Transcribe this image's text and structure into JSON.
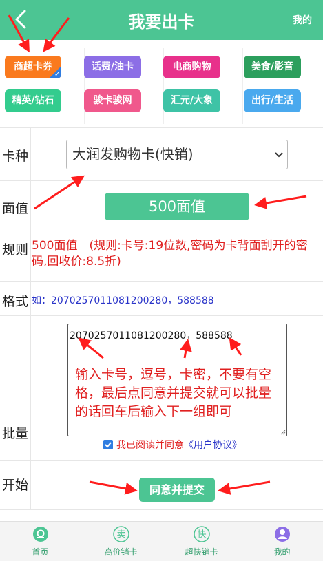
{
  "header": {
    "title": "我要出卡",
    "right_label": "我的",
    "bg_color": "#4cc593"
  },
  "categories": [
    {
      "label": "商超卡券",
      "color": "#fa7a1e",
      "selected": true
    },
    {
      "label": "话费/油卡",
      "color": "#8c6ee6"
    },
    {
      "label": "电商购物",
      "color": "#e8318b"
    },
    {
      "label": "美食/影音",
      "color": "#2c9f5d"
    },
    {
      "label": "精英/钻石",
      "color": "#33cc8e"
    },
    {
      "label": "骏卡骏网",
      "color": "#f0588c"
    },
    {
      "label": "汇元/大象",
      "color": "#3ec3a6"
    },
    {
      "label": "出行/生活",
      "color": "#4aa9ee"
    }
  ],
  "form": {
    "card_type_label": "卡种",
    "card_type_value": "大润发购物卡(快销)",
    "face_value_label": "面值",
    "face_value": "500面值",
    "rule_label": "规则",
    "rule_text": "500面值　(规则:卡号:19位数,密码为卡背面刮开的密码,回收价:8.5折)",
    "format_label": "格式",
    "format_text": "如：207025701108120028​0，588588",
    "batch_label": "批量",
    "batch_value": "2070257011081200280，588588",
    "batch_hint": "输入卡号，逗号，卡密，不要有空格，最后点同意并提交就可以批量的话回车后输入下一组即可",
    "agree_text": "我已阅读并同意",
    "agreement_link": "《用户协议》",
    "agreed": true,
    "start_label": "开始",
    "submit_label": "同意并提交"
  },
  "tabbar": [
    {
      "label": "首页",
      "icon": "home-icon",
      "glyph": "",
      "color": "#4cc593"
    },
    {
      "label": "高价销卡",
      "icon": "sell-icon",
      "glyph": "卖",
      "color": "#4cc593"
    },
    {
      "label": "超快销卡",
      "icon": "fast-icon",
      "glyph": "快",
      "color": "#4cc593"
    },
    {
      "label": "我的",
      "icon": "user-icon",
      "glyph": "",
      "color": "#8c6ee6"
    }
  ]
}
